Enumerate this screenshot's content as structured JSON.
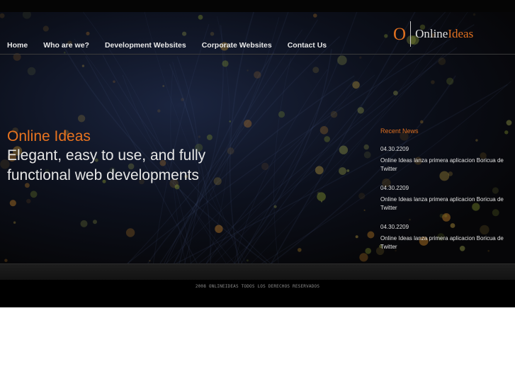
{
  "brand": {
    "logo_mark": "O",
    "name_part1": "Online",
    "name_part2": "Ideas",
    "accent": "#e07020"
  },
  "nav": [
    {
      "label": "Home"
    },
    {
      "label": "Who are we?"
    },
    {
      "label": "Development Websites"
    },
    {
      "label": "Corporate Websites"
    },
    {
      "label": "Contact Us"
    }
  ],
  "hero": {
    "title": "Online Ideas",
    "tagline_line1": "Elegant, easy to use, and fully",
    "tagline_line2": "functional web developments"
  },
  "news": {
    "title": "Recent News",
    "items": [
      {
        "date": "04.30.2209",
        "text": "Online Ideas lanza primera aplicacion Boricua de Twitter"
      },
      {
        "date": "04.30.2209",
        "text": "Online Ideas lanza primera aplicacion Boricua de Twitter"
      },
      {
        "date": "04.30.2209",
        "text": "Online Ideas lanza primera aplicacion Boricua de Twitter"
      }
    ]
  },
  "footer": {
    "copyright": "2008 ONLINEIDEAS TODOS LOS DERECHOS RESERVADOS"
  }
}
